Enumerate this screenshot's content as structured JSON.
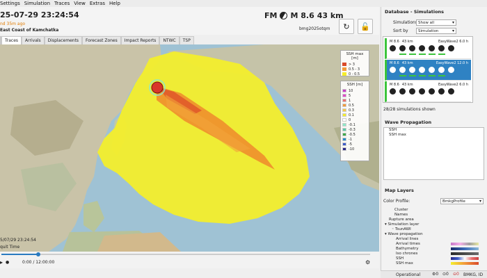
{
  "menu": [
    "Settings",
    "Simulation",
    "Traces",
    "View",
    "Extras",
    "Help"
  ],
  "header": {
    "time": "25-07-29 23:24:54",
    "ago": "nd 35m ago",
    "region": "East Coast of Kamchatka",
    "fm_label": "FM",
    "magnitude": "M 8.6",
    "depth": "43 km",
    "event_id": "bmg2025otqm",
    "refresh_icon": "↻",
    "lock_icon": "🔓"
  },
  "tabs": [
    "Traces",
    "Arrivals",
    "Displacements",
    "Forecast Zones",
    "Impact Reports",
    "NTWC",
    "TSP"
  ],
  "active_tab": "Traces",
  "legend_ssh_max": {
    "title": "SSH max [m]",
    "items": [
      {
        "label": "> 3",
        "color": "#d94a2a"
      },
      {
        "label": "0.5 - 3",
        "color": "#f29a3a"
      },
      {
        "label": "0 - 0.5",
        "color": "#f5ee2a"
      }
    ]
  },
  "legend_ssh": {
    "title": "SSH [m]",
    "items": [
      {
        "label": "10",
        "color": "#c83cc8"
      },
      {
        "label": "5",
        "color": "#e04ac8"
      },
      {
        "label": "1",
        "color": "#e87070"
      },
      {
        "label": "0.5",
        "color": "#f29a3a"
      },
      {
        "label": "0.3",
        "color": "#f5c84a"
      },
      {
        "label": "0.1",
        "color": "#f5ee2a"
      },
      {
        "label": "0",
        "color": "#ffffff"
      },
      {
        "label": "-0.1",
        "color": "#8ee8c8"
      },
      {
        "label": "-0.3",
        "color": "#5cc8a8"
      },
      {
        "label": "-0.5",
        "color": "#3ca848"
      },
      {
        "label": "-1",
        "color": "#2a8ac8"
      },
      {
        "label": "-5",
        "color": "#3a5ac8"
      },
      {
        "label": "-10",
        "color": "#2a2a8a"
      }
    ]
  },
  "map_time": "5/07/29 23:24:54",
  "map_time_label": "quit Time",
  "playback": {
    "time": "0:00 / 12:00:00",
    "progress": 0.1
  },
  "side": {
    "db_title": "Database - Simulations",
    "sim_label": "Simulations",
    "sim_value": "Show all",
    "sort_label": "Sort by",
    "sort_value": "Simulation",
    "cards": [
      {
        "mag": "M 8.6",
        "depth": "43 km",
        "engine": "EasyWave2 6.0 h"
      },
      {
        "mag": "M 8.6",
        "depth": "43 km",
        "engine": "EasyWave2 12.0 h"
      },
      {
        "mag": "M 8.6",
        "depth": "43 km",
        "engine": "EasyWave2 6.0 h"
      }
    ],
    "sim_count": "28/28 simulations shown",
    "wave_title": "Wave Propagation",
    "wave_items": [
      "SSH",
      "SSH max"
    ],
    "layers_title": "Map Layers",
    "color_profile_label": "Color Profile:",
    "color_profile_value": "BmkgProfile",
    "layers": [
      "Cluster",
      "Names",
      "Rupture area",
      "Simulation layer",
      "TsunAWI",
      "Wave propagation",
      "Arrival lines",
      "Arrival times",
      "Bathymetry",
      "Iso chrones",
      "SSH",
      "SSH max"
    ],
    "status_operational": "Operational",
    "status_counts": [
      "0",
      "0",
      "0"
    ],
    "status_agency": "BMKG, ID"
  },
  "colors": {
    "accent": "#2f82c3",
    "ok": "#3cc43c",
    "warn": "#e07b00"
  }
}
